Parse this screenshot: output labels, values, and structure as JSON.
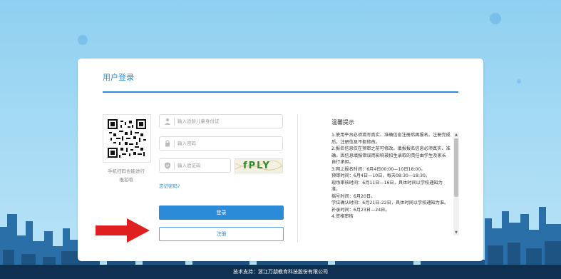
{
  "page": {
    "footer": "技术支持：浙江万朋教育科技股份有限公司"
  },
  "login": {
    "title": "用户登录",
    "qr_caption_line1": "手机扫码也能进行",
    "qr_caption_line2": "报名哦",
    "id_placeholder": "输入适龄儿童身份证",
    "password_placeholder": "输入密码",
    "captcha_placeholder": "输入验证码",
    "captcha_image_text": "fPLY",
    "forgot_password": "忘记密码?",
    "login_button": "登录",
    "register_button": "注册"
  },
  "notice": {
    "title": "温馨提示",
    "lines": [
      "1.使用平台必须填写真实、准确信息注册后再报名。注册完成后，注册信息不能修改。",
      "2.报名信息仅在预审之前可修改。填报报名信息必须真实、准确。因信息填报错误而影响被招生录取的责任由学生及家长自行承担。",
      "3.网上报名时间：6月4日00:00—10日18:00。",
      "预审时间：6月4日—10日，每天08:30—18:30。",
      "现场审核时间：6月11日—16日，具体时间以学校通知为准。",
      "摇号时间：6月20日。",
      "学位确认时间：6月21日-22日，具体时间以学校通知为准。",
      "补录时间：6月23日—24日。",
      "4.资格审核"
    ]
  },
  "colors": {
    "accent": "#2d8bd6",
    "arrow": "#e02020"
  },
  "icons": [
    "user-icon",
    "lock-icon",
    "shield-icon",
    "qr-code"
  ]
}
